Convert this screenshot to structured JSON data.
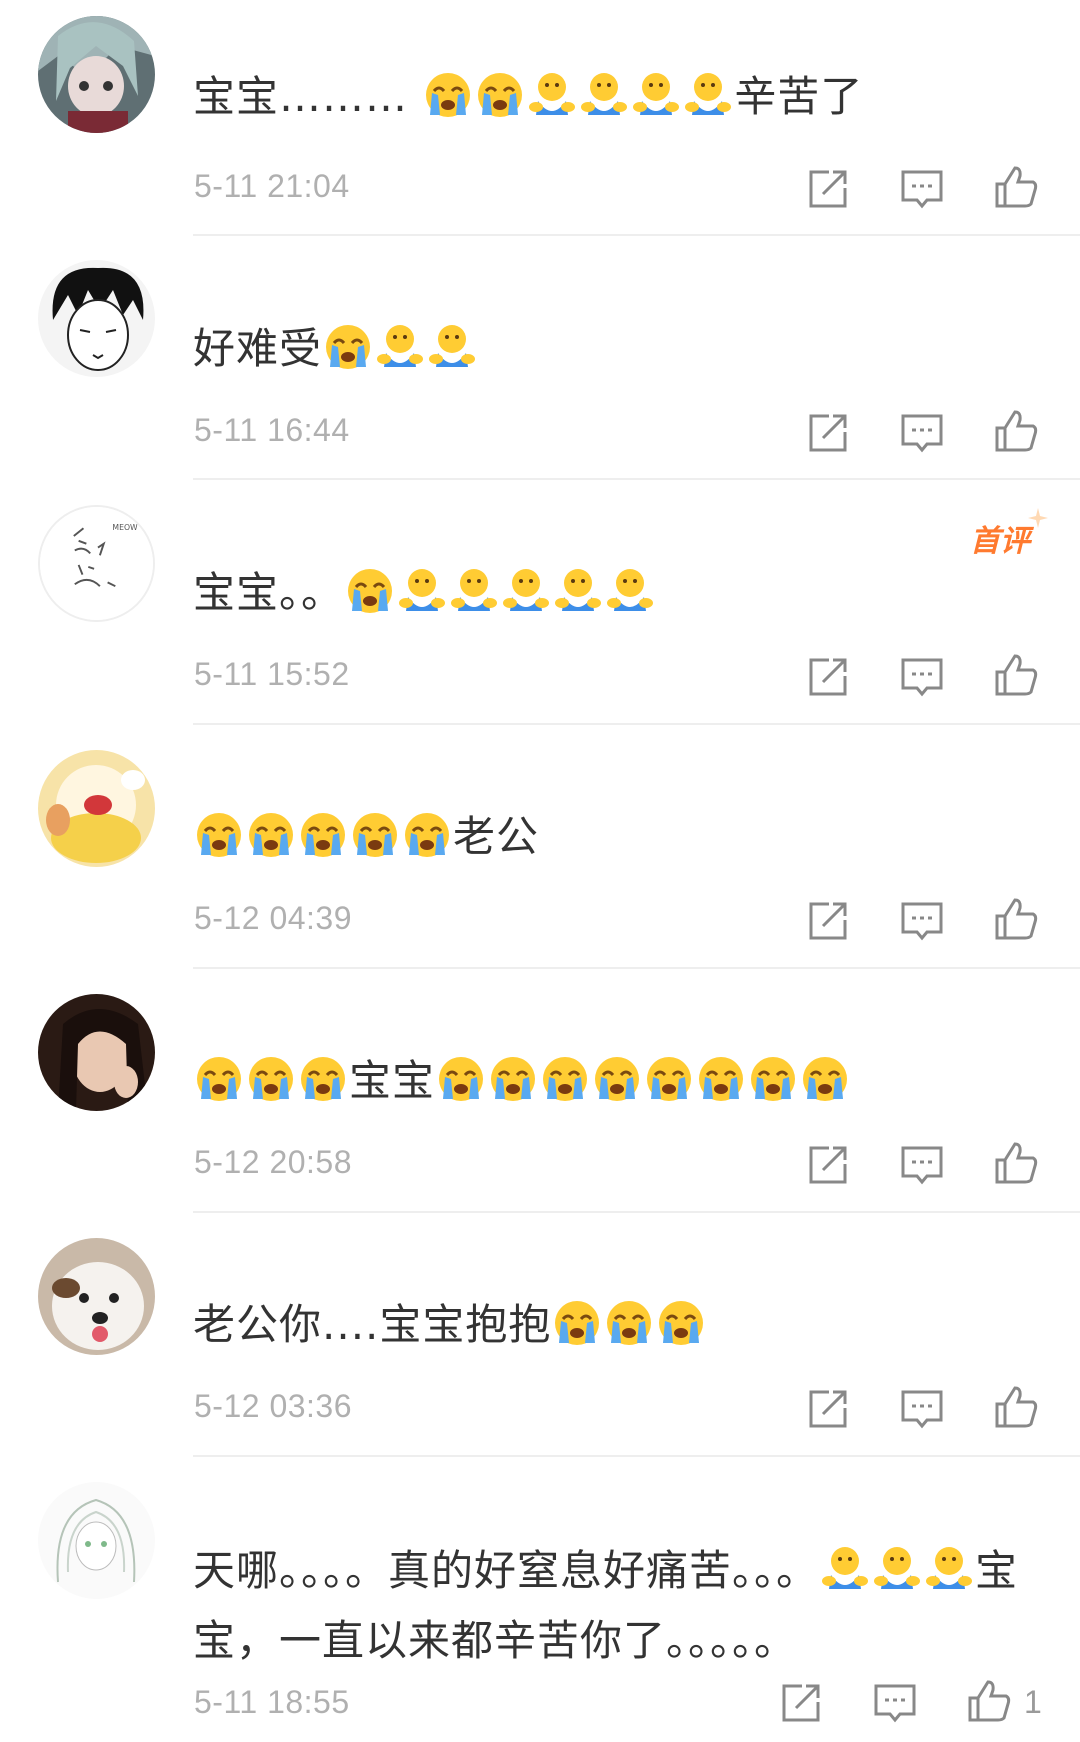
{
  "comments": [
    {
      "text_a": "宝宝……… ",
      "text_b": "辛苦了",
      "time": "5-11 21:04"
    },
    {
      "text": "好难受",
      "time": "5-11 16:44"
    },
    {
      "text": "宝宝。。",
      "time": "5-11 15:52",
      "badge": "首评"
    },
    {
      "text": "老公",
      "time": "5-12 04:39"
    },
    {
      "text": "宝宝",
      "time": "5-12 20:58"
    },
    {
      "text": "老公你....宝宝抱抱",
      "time": "5-12 03:36"
    },
    {
      "text_a": "天哪。。。。真的好窒息好痛苦。。。",
      "text_b": "宝宝，一直以来都辛苦你了。。。。。",
      "time": "5-11 18:55",
      "likes": "1"
    }
  ],
  "icons": {
    "share": "share-icon",
    "reply": "reply-icon",
    "like": "thumbs-up-icon",
    "cry": "crying-emoji",
    "hug": "hug-emoji"
  },
  "colors": {
    "badge": "#ff7a2f",
    "time": "#b0b0b0",
    "divider": "#eeeeee",
    "icon": "#888888"
  }
}
